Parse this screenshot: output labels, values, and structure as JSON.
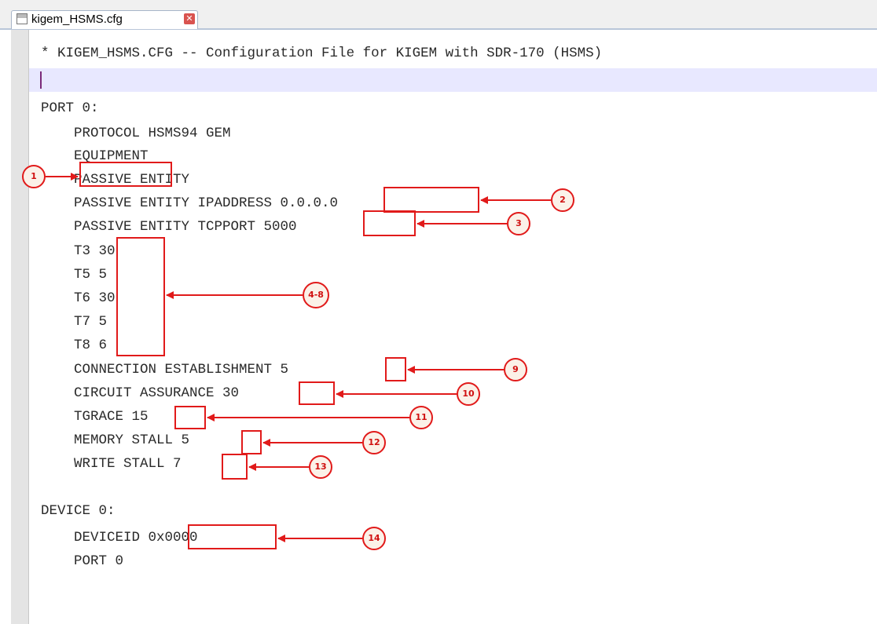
{
  "tab": {
    "filename": "kigem_HSMS.cfg",
    "close_icon": "close-icon"
  },
  "lines": [
    "* KIGEM_HSMS.CFG -- Configuration File for KIGEM with SDR-170 (HSMS)",
    "",
    "PORT 0:",
    "    PROTOCOL HSMS94 GEM",
    "    EQUIPMENT",
    "    PASSIVE ENTITY",
    "    PASSIVE ENTITY IPADDRESS 0.0.0.0",
    "    PASSIVE ENTITY TCPPORT 5000",
    "    T3 30",
    "    T5 5",
    "    T6 30",
    "    T7 5",
    "    T8 6",
    "    CONNECTION ESTABLISHMENT 5",
    "    CIRCUIT ASSURANCE 30",
    "    TGRACE 15",
    "    MEMORY STALL 5",
    "    WRITE STALL 7",
    "",
    "DEVICE 0:",
    "    DEVICEID 0x0000",
    "    PORT 0"
  ],
  "callouts": [
    "1",
    "2",
    "3",
    "4-8",
    "9",
    "10",
    "11",
    "12",
    "13",
    "14"
  ],
  "colors": {
    "annotation": "#e11a1a",
    "current_line": "#e8e8ff",
    "gutter": "#e4e4e4"
  }
}
